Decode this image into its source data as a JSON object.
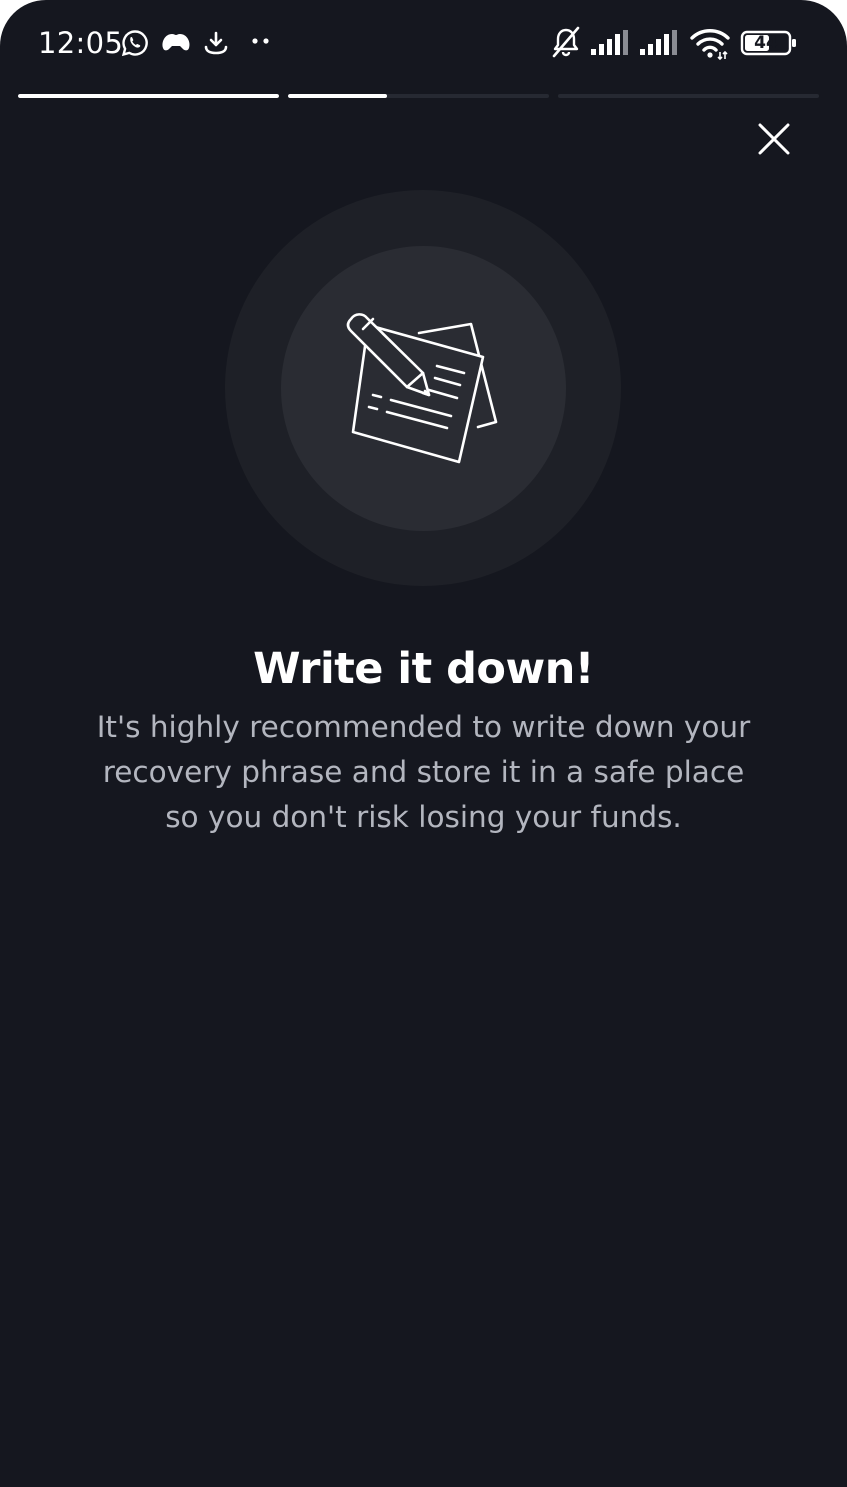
{
  "status_bar": {
    "time": "12:05",
    "battery": "44",
    "icons": [
      "whatsapp-icon",
      "game-controller-icon",
      "download-icon",
      "more-dots-icon",
      "bell-off-icon",
      "signal-icon",
      "signal-icon",
      "wifi-icon",
      "battery-icon"
    ]
  },
  "progress": {
    "segments": [
      1.0,
      0.38,
      0.0,
      0.0
    ]
  },
  "header": {
    "close_icon": "close-icon"
  },
  "illustration": {
    "icon": "notepad-pencil-icon"
  },
  "content": {
    "title": "Write it down!",
    "description_lines": [
      "It's highly recommended to write down your",
      "recovery phrase and store it in a safe place",
      "so you don't risk losing your funds."
    ]
  },
  "colors": {
    "background": "#15171f",
    "outer_circle": "#1e2027",
    "inner_circle": "#2a2c33",
    "text_primary": "#ffffff",
    "text_secondary": "#b3b6bf"
  }
}
